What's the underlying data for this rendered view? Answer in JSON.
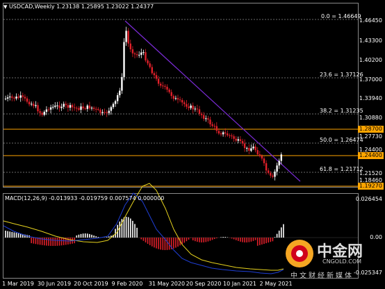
{
  "header": {
    "symbol_line": "USDCAD,Weekly  1.23138 1.25895 1.23022 1.24377"
  },
  "price_axis": {
    "labels": [
      "1.46450",
      "1.43300",
      "1.40200",
      "1.37000",
      "1.33940",
      "1.30880",
      "1.27730",
      "1.24400",
      "1.21520",
      "1.18460"
    ],
    "boxed": [
      {
        "text": "1.28700",
        "color": "#ffa500"
      },
      {
        "text": "1.24400",
        "color": "#ffa500"
      },
      {
        "text": "1.19270",
        "color": "#ffa500"
      }
    ]
  },
  "fibo": [
    {
      "text": "0.0 = 1.46649"
    },
    {
      "text": "23.6 = 1.37126"
    },
    {
      "text": "38.2 = 1.31235"
    },
    {
      "text": "50.0 = 1.26474"
    },
    {
      "text": "61.8 = 1.21712"
    }
  ],
  "macd": {
    "title": "MACD(12,26,9) -0.013933 -0.019759 0.007574 0.000000",
    "axis": [
      "0.026454",
      "0.00",
      "-0.025347"
    ]
  },
  "time_axis": [
    "1 Mar 2019",
    "30 Jun 2019",
    "20 Oct 2019",
    "9 Feb 2020",
    "31 May 2020",
    "20 Sep 2020",
    "10 Jan 2021",
    "2 May 2021"
  ],
  "watermark": {
    "brand": "中金网",
    "domain": "CNGOLD.COM",
    "slogan": "中文财经新媒体"
  },
  "colors": {
    "bull": "#ffffff",
    "bear": "#e0202a",
    "level": "#ffa500",
    "trend": "#7b2bd6",
    "signal": "#e6d21e",
    "macd_line": "#1f3fd6",
    "background": "#000000"
  }
}
